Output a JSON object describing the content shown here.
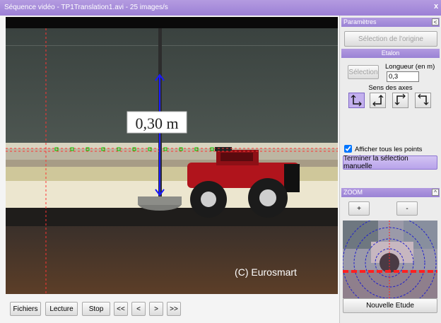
{
  "window": {
    "title": "Séquence vidéo - TP1Translation1.avi - 25 images/s",
    "close_glyph": "x"
  },
  "video": {
    "measure_label": "0,30 m",
    "watermark": "(C) Eurosmart"
  },
  "playback": {
    "files": "Fichiers",
    "play": "Lecture",
    "stop": "Stop",
    "first": "<<",
    "prev": "<",
    "next": ">",
    "last": ">>"
  },
  "params": {
    "header": "Paramètres",
    "collapse_glyph": "<",
    "origin_button": "Sélection de l'origine",
    "etalon_header": "Etalon",
    "selection_button": "Sélection",
    "length_label": "Longueur (en m)",
    "length_value": "0,3",
    "axes_label": "Sens des axes",
    "show_points_label": "Afficher tous les points",
    "show_points_checked": true,
    "finish_button": "Terminer la sélection manuelle"
  },
  "zoom": {
    "header": "ZOOM",
    "collapse_glyph": "^",
    "plus": "+",
    "minus": "-"
  },
  "new_study": "Nouvelle Etude",
  "colors": {
    "accent": "#9c80d6",
    "trajectory_marker": "#00cc00",
    "measure_arrow": "#1a1aff",
    "guide_line": "#ff3333"
  }
}
